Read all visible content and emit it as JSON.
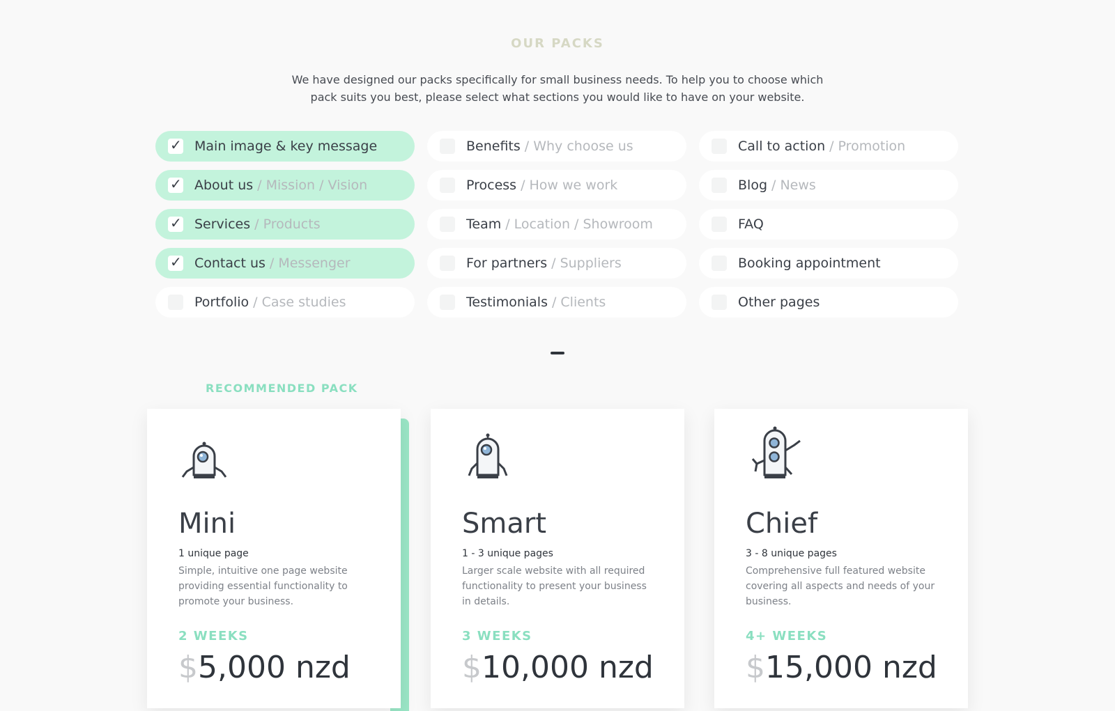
{
  "header": {
    "title": "OUR PACKS",
    "intro_line1": "We have designed our packs specifically for small business needs. To help you to choose which",
    "intro_line2": "pack suits you best, please select what sections you would like to have on your website."
  },
  "options": [
    {
      "label": "Main image & key message",
      "sub": "",
      "checked": true
    },
    {
      "label": "Benefits",
      "sub": "/ Why choose us",
      "checked": false
    },
    {
      "label": "Call to action",
      "sub": "/ Promotion",
      "checked": false
    },
    {
      "label": "About us",
      "sub": "/ Mission / Vision",
      "checked": true
    },
    {
      "label": "Process",
      "sub": "/ How we work",
      "checked": false
    },
    {
      "label": "Blog",
      "sub": "/ News",
      "checked": false
    },
    {
      "label": "Services",
      "sub": "/ Products",
      "checked": true
    },
    {
      "label": "Team",
      "sub": "/ Location / Showroom",
      "checked": false
    },
    {
      "label": "FAQ",
      "sub": "",
      "checked": false
    },
    {
      "label": "Contact us",
      "sub": "/ Messenger",
      "checked": true
    },
    {
      "label": "For partners",
      "sub": "/ Suppliers",
      "checked": false
    },
    {
      "label": "Booking appointment",
      "sub": "",
      "checked": false
    },
    {
      "label": "Portfolio",
      "sub": "/ Case studies",
      "checked": false
    },
    {
      "label": "Testimonials",
      "sub": "/ Clients",
      "checked": false
    },
    {
      "label": "Other pages",
      "sub": "",
      "checked": false
    }
  ],
  "recommended_label": "RECOMMENDED PACK",
  "packs": [
    {
      "name": "Mini",
      "pages": "1 unique page",
      "description": "Simple, intuitive one page website providing essential functionality to promote your business.",
      "weeks": "2 WEEKS",
      "currency": "$",
      "price": "5,000 nzd",
      "icon": "robot-mini-icon"
    },
    {
      "name": "Smart",
      "pages": "1 - 3 unique pages",
      "description": "Larger scale website with all required functionality to present your business in details.",
      "weeks": "3 WEEKS",
      "currency": "$",
      "price": "10,000 nzd",
      "icon": "robot-smart-icon"
    },
    {
      "name": "Chief",
      "pages": "3 - 8 unique pages",
      "description": "Comprehensive full featured website covering all aspects and needs of your business.",
      "weeks": "4+ WEEKS",
      "currency": "$",
      "price": "15,000 nzd",
      "icon": "robot-chief-icon"
    }
  ],
  "colors": {
    "accent": "#8adfc0",
    "checked_bg": "#c3f3dc",
    "text": "#3a3f47"
  }
}
